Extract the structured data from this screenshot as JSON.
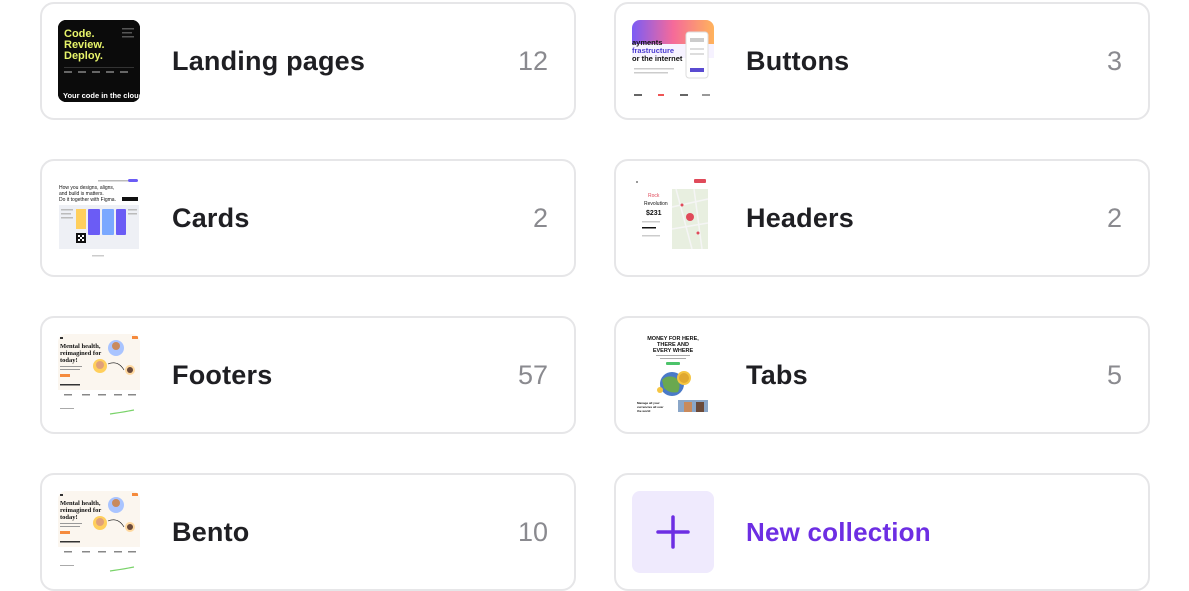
{
  "collections": [
    {
      "title": "Landing pages",
      "count": "12",
      "thumb_text": [
        "Code.",
        "Review.",
        "Deploy."
      ],
      "thumb_caption": "Your code in the cloud"
    },
    {
      "title": "Buttons",
      "count": "3",
      "thumb_text": [
        "ayments",
        "frastructure",
        "or the internet"
      ]
    },
    {
      "title": "Cards",
      "count": "2",
      "thumb_text": [
        "How you designs,  aligns,",
        "and build is matters.",
        "Do it together with Figma."
      ]
    },
    {
      "title": "Headers",
      "count": "2",
      "thumb_text": [
        "Rock",
        "Revolution",
        "$231"
      ]
    },
    {
      "title": "Footers",
      "count": "57",
      "thumb_text": [
        "Mental health,",
        "reimagined for",
        "today!"
      ]
    },
    {
      "title": "Tabs",
      "count": "5",
      "thumb_text": [
        "MONEY FOR HERE,",
        "THERE AND",
        "EVERY WHERE"
      ]
    },
    {
      "title": "Bento",
      "count": "10",
      "thumb_text": [
        "Mental health,",
        "reimagined for",
        "today!"
      ]
    }
  ],
  "new_collection": {
    "label": "New collection"
  },
  "colors": {
    "accent": "#6d2ee3",
    "accent_bg": "#efeafd",
    "border": "#e6e6e8",
    "title": "#1f1f23",
    "count": "#8a8a8f",
    "code_yellow": "#e8f56a"
  }
}
